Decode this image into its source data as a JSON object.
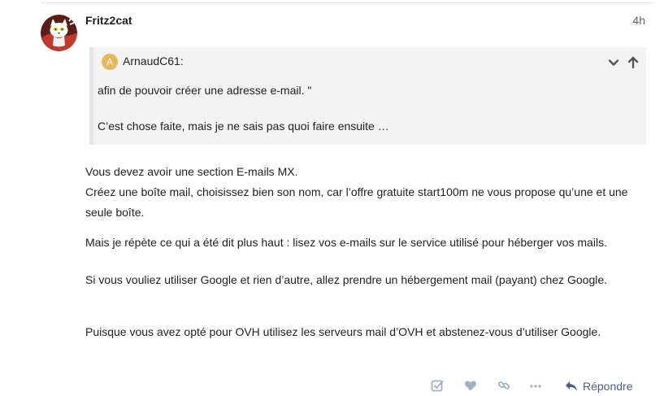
{
  "post": {
    "username": "Fritz2cat",
    "time": "4h",
    "avatar_icon": "cat-avatar-icon"
  },
  "quote": {
    "author_initial": "A",
    "author": "ArnaudC61:",
    "avatar_color": "#e8b75a",
    "lines": [
      "afin de pouvoir créer une adresse e-mail. \"",
      "C’est chose faite, mais je ne sais pas quoi faire ensuite …"
    ]
  },
  "body": {
    "p1_line1": "Vous devez avoir une section E-mails MX.",
    "p1_line2": "Créez une boîte mail, choisissez bien son nom, car l’offre gratuite start100m ne vous propose qu’une et une seule boîte.",
    "p2": "Mais je répète ce qui a été dit plus haut : lisez vos e-mails sur le service utilisé pour héberger vos mails.",
    "p3": "Si vous vouliez utiliser Google et rien d’autre, allez prendre un hébergement mail (payant) chez Google.",
    "p4": "Puisque vous avez opté pour OVH utilisez les serveurs mail d’OVH et abstenez-vous d’utiliser Google."
  },
  "actions": {
    "icons": [
      "check-square-icon",
      "heart-icon",
      "link-icon",
      "more-icon"
    ],
    "reply_icon": "reply-icon",
    "reply_label": "Répondre",
    "icon_color": "#a3b0c5",
    "accent_color": "#4a5f86"
  }
}
